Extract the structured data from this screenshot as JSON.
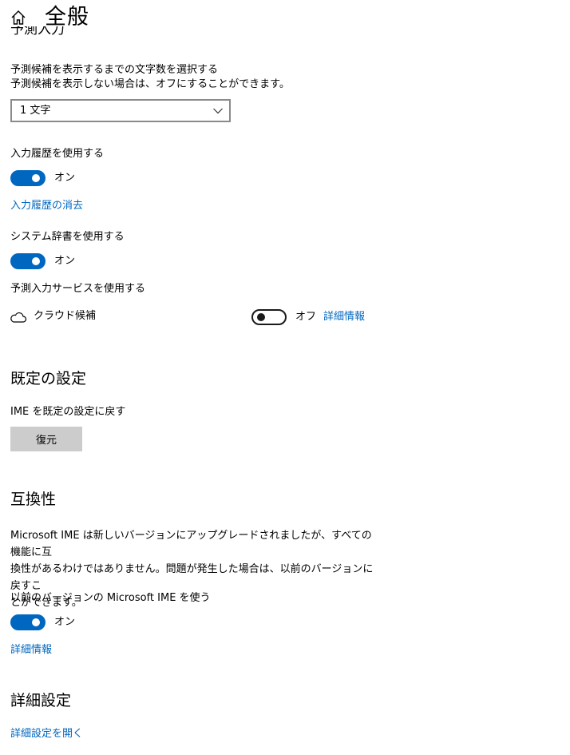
{
  "header": {
    "title": "全般",
    "home_icon": "home-icon"
  },
  "predict": {
    "heading": "予測入力",
    "select_desc_1": "予測候補を表示するまでの文字数を選択する",
    "select_desc_2": "予測候補を表示しない場合は、オフにすることができます。",
    "select_value": "1 文字"
  },
  "history": {
    "label": "入力履歴を使用する",
    "toggle_state": "オン",
    "toggle_on": true,
    "clear_link": "入力履歴の消去"
  },
  "system_dict": {
    "label": "システム辞書を使用する",
    "toggle_state": "オン",
    "toggle_on": true
  },
  "predict_service": {
    "label": "予測入力サービスを使用する",
    "cloud_label": "クラウド候補",
    "cloud_icon": "cloud-icon",
    "toggle_state": "オフ",
    "toggle_on": false,
    "detail_link": "詳細情報"
  },
  "default_settings": {
    "heading": "既定の設定",
    "reset_label": "IME を既定の設定に戻す",
    "restore_button": "復元"
  },
  "compat": {
    "heading": "互換性",
    "desc_line1": "Microsoft IME は新しいバージョンにアップグレードされましたが、すべての機能に互",
    "desc_line2": "換性があるわけではありません。問題が発生した場合は、以前のバージョンに戻すこ",
    "desc_line3": "とができます。",
    "use_prev_label": "以前のバージョンの Microsoft IME を使う",
    "toggle_state": "オン",
    "toggle_on": true,
    "detail_link": "詳細情報"
  },
  "advanced": {
    "heading": "詳細設定",
    "open_link": "詳細設定を開く"
  },
  "colors": {
    "accent": "#0067c0",
    "button_bg": "#cccccc"
  }
}
